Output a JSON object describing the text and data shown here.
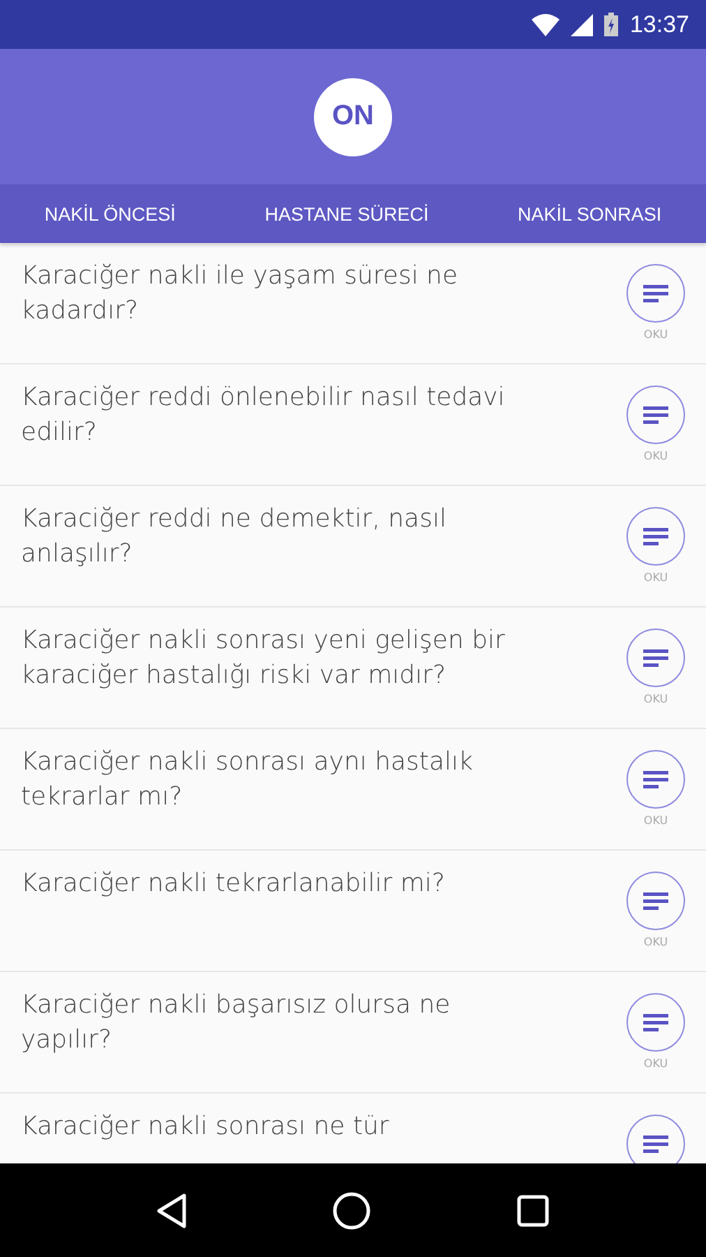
{
  "status_bar": {
    "time": "13:37"
  },
  "header": {
    "logo": "ON"
  },
  "tabs": [
    {
      "label": "NAKİL ÖNCESİ"
    },
    {
      "label": "HASTANE SÜRECİ"
    },
    {
      "label": "NAKİL SONRASI"
    }
  ],
  "questions": [
    {
      "text": "Karaciğer nakli ile yaşam süresi ne kadardır?",
      "action": "OKU"
    },
    {
      "text": "Karaciğer reddi önlenebilir nasıl tedavi edilir?",
      "action": "OKU"
    },
    {
      "text": "Karaciğer reddi ne demektir, nasıl anlaşılır?",
      "action": "OKU"
    },
    {
      "text": "Karaciğer nakli sonrası yeni gelişen bir karaciğer hastalığı riski var mıdır?",
      "action": "OKU"
    },
    {
      "text": "Karaciğer nakli sonrası aynı hastalık tekrarlar mı?",
      "action": "OKU"
    },
    {
      "text": "Karaciğer nakli tekrarlanabilir mi?",
      "action": "OKU"
    },
    {
      "text": "Karaciğer nakli başarısız olursa ne yapılır?",
      "action": "OKU"
    },
    {
      "text": "Karaciğer nakli sonrası ne tür"
    }
  ]
}
